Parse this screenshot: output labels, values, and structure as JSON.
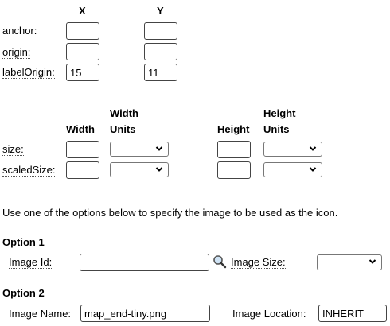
{
  "offsets": {
    "col_x": "X",
    "col_y": "Y",
    "rows": [
      {
        "label": "anchor:",
        "x": "",
        "y": ""
      },
      {
        "label": "origin:",
        "x": "",
        "y": ""
      },
      {
        "label": "labelOrigin:",
        "x": "15",
        "y": "11"
      }
    ]
  },
  "sizes": {
    "col_width": "Width",
    "col_width_units_line1": "Width",
    "col_width_units_line2": "Units",
    "col_height": "Height",
    "col_height_units_line1": "Height",
    "col_height_units_line2": "Units",
    "rows": [
      {
        "label": "size:",
        "width": "",
        "width_units": "",
        "height": "",
        "height_units": ""
      },
      {
        "label": "scaledSize:",
        "width": "",
        "width_units": "",
        "height": "",
        "height_units": ""
      }
    ]
  },
  "instructions": "Use one of the options below to specify the image to be used as the icon.",
  "option1": {
    "title": "Option 1",
    "image_id_label": "Image Id:",
    "image_id_value": "",
    "image_size_label": "Image Size:",
    "image_size_value": "",
    "lookup_icon": "magnifier-icon"
  },
  "option2": {
    "title": "Option 2",
    "image_name_label": "Image Name:",
    "image_name_value": "map_end-tiny.png",
    "image_location_label": "Image Location:",
    "image_location_value": "INHERIT"
  }
}
